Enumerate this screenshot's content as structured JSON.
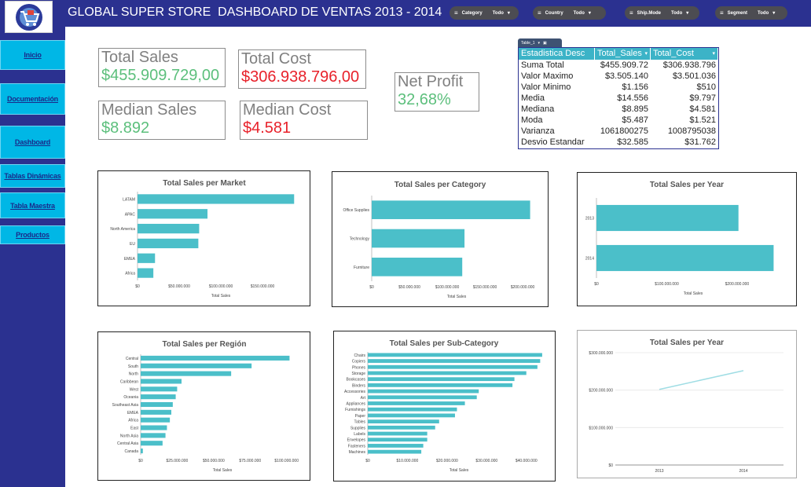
{
  "header": {
    "logo_icon": "store-cart-logo-icon",
    "title_store": "GLOBAL SUPER STORE",
    "title_dashboard": "DASHBOARD DE VENTAS 2013 - 2014",
    "filters": [
      {
        "label": "Category",
        "value": "Todo"
      },
      {
        "label": "Country",
        "value": "Todo"
      },
      {
        "label": "Ship.Mode",
        "value": "Todo"
      },
      {
        "label": "Segment",
        "value": "Todo"
      }
    ]
  },
  "sidebar": {
    "items": [
      {
        "label": "Inicio"
      },
      {
        "label": "Documentación"
      },
      {
        "label": "Dashboard"
      },
      {
        "label": "Tablas Dinámicas"
      },
      {
        "label": "Tabla Maestra"
      },
      {
        "label": "Productos"
      }
    ]
  },
  "kpis": {
    "total_sales": {
      "label": "Total Sales",
      "value": "$455.909.729,00"
    },
    "total_cost": {
      "label": "Total Cost",
      "value": "$306.938.796,00"
    },
    "net_profit": {
      "label": "Net Profit",
      "value": "32,68%"
    },
    "median_sales": {
      "label": "Median Sales",
      "value": "$8.892"
    },
    "median_cost": {
      "label": "Median Cost",
      "value": "$4.581"
    }
  },
  "stats_table": {
    "tab_label": "Table_1",
    "headers": [
      "Estadistica Desc",
      "Total_Sales",
      "Total_Cost"
    ],
    "rows": [
      [
        "Suma Total",
        "$455.909.72",
        "$306.938.796"
      ],
      [
        "Valor Maximo",
        "$3.505.140",
        "$3.501.036"
      ],
      [
        "Valor Minimo",
        "$1.156",
        "$510"
      ],
      [
        "Media",
        "$14.556",
        "$9.797"
      ],
      [
        "Mediana",
        "$8.895",
        "$4.581"
      ],
      [
        "Moda",
        "$5.487",
        "$1.521"
      ],
      [
        "Varianza",
        "1061800275",
        "1008795038"
      ],
      [
        "Desvio Estandar",
        "$32.585",
        "$31.762"
      ]
    ]
  },
  "colors": {
    "bar": "#4bbfc9",
    "header_bg": "#2b3190",
    "nav_bg": "#00b7e6",
    "positive": "#5cbf7c",
    "negative": "#e8212a"
  },
  "chart_data": [
    {
      "type": "bar",
      "orientation": "horizontal",
      "title": "Total Sales per Market",
      "categories": [
        "LATAM",
        "APAC",
        "North America",
        "EU",
        "EMEA",
        "Africa"
      ],
      "values": [
        188000000,
        84000000,
        74000000,
        73000000,
        21000000,
        19000000
      ],
      "xlabel": "Total Sales",
      "xlim": [
        0,
        200000000
      ],
      "ticks": [
        0,
        50000000,
        100000000,
        150000000
      ],
      "tick_labels": [
        "$0",
        "$50.000.000",
        "$100.000.000",
        "$150.000.000"
      ]
    },
    {
      "type": "bar",
      "orientation": "horizontal",
      "title": "Total Sales per Category",
      "categories": [
        "Office Supplies",
        "Technology",
        "Furniture"
      ],
      "values": [
        210000000,
        123000000,
        120000000
      ],
      "xlabel": "Total Sales",
      "xlim": [
        0,
        225000000
      ],
      "ticks": [
        0,
        50000000,
        100000000,
        150000000,
        200000000
      ],
      "tick_labels": [
        "$0",
        "$50.000.000",
        "$100.000.000",
        "$150.000.000",
        "$200.000.000"
      ]
    },
    {
      "type": "bar",
      "orientation": "horizontal",
      "title": "Total Sales per Year",
      "categories": [
        "2013",
        "2014"
      ],
      "values": [
        202000000,
        252000000
      ],
      "xlabel": "Total Sales",
      "xlim": [
        0,
        275000000
      ],
      "ticks": [
        0,
        100000000,
        200000000
      ],
      "tick_labels": [
        "$0",
        "$100.000.000",
        "$200.000.000"
      ]
    },
    {
      "type": "bar",
      "orientation": "horizontal",
      "title": "Total Sales per Región",
      "categories": [
        "Central",
        "South",
        "North",
        "Caribbean",
        "West",
        "Oceania",
        "Southeast Asia",
        "EMEA",
        "Africa",
        "East",
        "North Asia",
        "Central Asia",
        "Canada"
      ],
      "values": [
        102000000,
        76000000,
        62000000,
        28000000,
        25000000,
        24000000,
        22000000,
        21000000,
        20000000,
        18000000,
        17000000,
        15000000,
        1500000
      ],
      "xlabel": "Total Sales",
      "xlim": [
        0,
        112000000
      ],
      "ticks": [
        0,
        25000000,
        50000000,
        75000000,
        100000000
      ],
      "tick_labels": [
        "$0",
        "$25.000.000",
        "$50.000.000",
        "$75.000.000",
        "$100.000.000"
      ]
    },
    {
      "type": "bar",
      "orientation": "horizontal",
      "title": "Total Sales per Sub-Category",
      "categories": [
        "Chairs",
        "Copiers",
        "Phones",
        "Storage",
        "Bookcases",
        "Binders",
        "Accessories",
        "Art",
        "Appliances",
        "Furnishings",
        "Paper",
        "Tables",
        "Supplies",
        "Labels",
        "Envelopes",
        "Fasteners",
        "Machines"
      ],
      "values": [
        44000000,
        43500000,
        42800000,
        40000000,
        37000000,
        36500000,
        28000000,
        27500000,
        24500000,
        22500000,
        22000000,
        18000000,
        17000000,
        15000000,
        15000000,
        14000000,
        13500000
      ],
      "xlabel": "Total Sales",
      "xlim": [
        0,
        46000000
      ],
      "ticks": [
        0,
        10000000,
        20000000,
        30000000,
        40000000
      ],
      "tick_labels": [
        "$0",
        "$10.000.000",
        "$20.000.000",
        "$30.000.000",
        "$40.000.000"
      ]
    },
    {
      "type": "line",
      "title": "Total Sales per Year",
      "x": [
        "2013",
        "2014"
      ],
      "series": [
        {
          "values": [
            202000000,
            252000000
          ]
        }
      ],
      "ylim": [
        0,
        300000000
      ],
      "ticks": [
        0,
        100000000,
        200000000,
        300000000
      ],
      "tick_labels": [
        "$0",
        "$100.000.000",
        "$200.000.000",
        "$300.000.000"
      ],
      "grid": true
    }
  ]
}
